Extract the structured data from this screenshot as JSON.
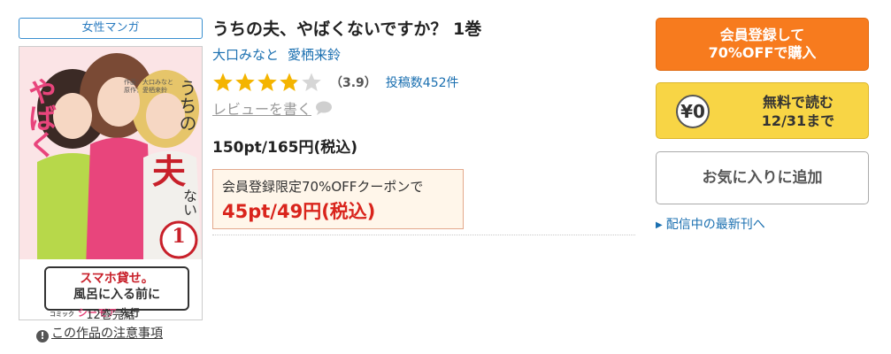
{
  "genre_badge": "女性マンガ",
  "cover": {
    "series_title_vertical": "うちの夫、やばくないですか？",
    "volume_number": "1",
    "credits": "作画：大口みなと　原作：愛栖来鈴",
    "speech_bubble": [
      "スマホ貸せ。",
      "風呂に入る前に"
    ],
    "brand_small": "コミック",
    "brand_logo": "シーモア",
    "brand_suffix": "先行",
    "colors": {
      "pink": "#e8457c",
      "green": "#b7d84a",
      "hair_dark": "#3b2a25",
      "hair_blond": "#e6c56a"
    }
  },
  "completed_label": "12巻完結",
  "notice_icon": "!",
  "notice_link": "この作品の注意事項",
  "title": "うちの夫、やばくないですか？ 1巻",
  "authors": [
    "大口みなと",
    "愛栖来鈴"
  ],
  "rating": {
    "value": 3.9,
    "display": "（3.9）",
    "post_count": "投稿数452件"
  },
  "review_link": "レビューを書く",
  "price": "150pt/165円(税込)",
  "coupon": {
    "label": "会員登録限定70%OFFクーポンで",
    "price": "45pt/49円(税込)"
  },
  "buttons": {
    "register_line1": "会員登録して",
    "register_line2": "70%OFFで購入",
    "free_badge": "¥0",
    "free_line1": "無料で読む",
    "free_line2": "12/31まで",
    "favorite": "お気に入りに追加"
  },
  "latest_link": "配信中の最新刊へ",
  "colors": {
    "orange": "#f77b1e",
    "yellow": "#f8d545",
    "link": "#1a6fb0",
    "coupon_red": "#d9241c",
    "star": "#f4b400"
  }
}
